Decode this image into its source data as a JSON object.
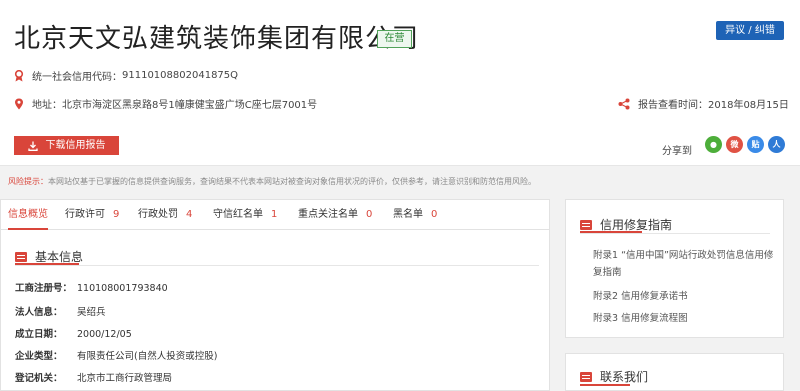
{
  "company": {
    "name": "北京天文弘建筑装饰集团有限公司",
    "status": "在营",
    "feedback_button": "异议 / 纠错",
    "credit_code_label": "统一社会信用代码：",
    "credit_code": "91110108802041875Q",
    "address_label": "地址：",
    "address": "北京市海淀区黑泉路8号1幢康健宝盛广场C座七层7001号",
    "report_time_label": "报告查看时间：",
    "report_time": "2018年08月15日",
    "download_button": "下载信用报告",
    "share_label": "分享到",
    "share_icons": [
      "wechat-icon",
      "weibo-icon",
      "tieba-icon",
      "renren-icon"
    ],
    "share_glyphs": [
      "●",
      "微",
      "贴",
      "人"
    ]
  },
  "risk": {
    "label": "风险提示：",
    "text": "本网站仅基于已掌握的信息提供查询服务，查询结果不代表本网站对被查询对象信用状况的评价，仅供参考，请注意识别和防范信用风险。"
  },
  "tabs": [
    {
      "label": "信息概览",
      "count": ""
    },
    {
      "label": "行政许可",
      "count": "9"
    },
    {
      "label": "行政处罚",
      "count": "4"
    },
    {
      "label": "守信红名单",
      "count": "1"
    },
    {
      "label": "重点关注名单",
      "count": "0"
    },
    {
      "label": "黑名单",
      "count": "0"
    }
  ],
  "basic_info": {
    "title": "基本信息",
    "fields": [
      {
        "key": "工商注册号：",
        "value": "110108001793840"
      },
      {
        "key": "法人信息：",
        "value": "吴绍兵"
      },
      {
        "key": "成立日期：",
        "value": "2000/12/05"
      },
      {
        "key": "企业类型：",
        "value": "有限责任公司(自然人投资或控股)"
      },
      {
        "key": "登记机关：",
        "value": "北京市工商行政管理局"
      }
    ]
  },
  "repair_guide": {
    "title": "信用修复指南",
    "links": [
      "附录1 “信用中国”网站行政处罚信息信用修复指南",
      "附录2 信用修复承诺书",
      "附录3 信用修复流程图"
    ]
  },
  "contact": {
    "title": "联系我们"
  },
  "colors": {
    "accent": "#d9453a",
    "primary": "#1e63b6",
    "status": "#2f8a38"
  }
}
